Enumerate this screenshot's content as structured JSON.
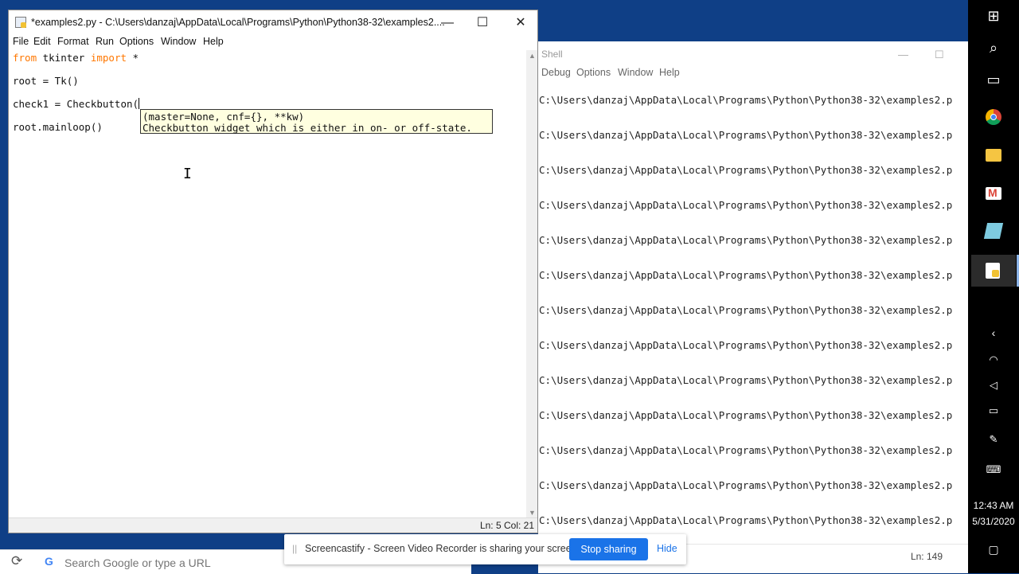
{
  "editor": {
    "title": "*examples2.py - C:\\Users\\danzaj\\AppData\\Local\\Programs\\Python\\Python38-32\\examples2....",
    "controls": {
      "minimize": "—",
      "maximize": "☐",
      "close": "✕"
    },
    "menu": [
      "File",
      "Edit",
      "Format",
      "Run",
      "Options",
      "Window",
      "Help"
    ],
    "code": {
      "line1_kw1": "from",
      "line1_mid": " tkinter ",
      "line1_kw2": "import",
      "line1_end": " *",
      "line3": "root = Tk()",
      "line5": "check1 = Checkbutton(",
      "line7": "root.mainloop()"
    },
    "tooltip": {
      "signature": "(master=None, cnf={}, **kw)",
      "doc": "Checkbutton widget which is either in on- or off-state."
    },
    "status": "Ln: 5   Col: 21"
  },
  "shell": {
    "title": "Shell",
    "menu": [
      "Debug",
      "Options",
      "Window",
      "Help"
    ],
    "line_text": "C:\\Users\\danzaj\\AppData\\Local\\Programs\\Python\\Python38-32\\examples2.p",
    "lines": [
      "C:\\Users\\danzaj\\AppData\\Local\\Programs\\Python\\Python38-32\\examples2.p",
      "C:\\Users\\danzaj\\AppData\\Local\\Programs\\Python\\Python38-32\\examples2.p",
      "C:\\Users\\danzaj\\AppData\\Local\\Programs\\Python\\Python38-32\\examples2.p",
      "C:\\Users\\danzaj\\AppData\\Local\\Programs\\Python\\Python38-32\\examples2.p",
      "C:\\Users\\danzaj\\AppData\\Local\\Programs\\Python\\Python38-32\\examples2.p",
      "C:\\Users\\danzaj\\AppData\\Local\\Programs\\Python\\Python38-32\\examples2.p",
      "C:\\Users\\danzaj\\AppData\\Local\\Programs\\Python\\Python38-32\\examples2.p",
      "C:\\Users\\danzaj\\AppData\\Local\\Programs\\Python\\Python38-32\\examples2.p",
      "C:\\Users\\danzaj\\AppData\\Local\\Programs\\Python\\Python38-32\\examples2.p",
      "C:\\Users\\danzaj\\AppData\\Local\\Programs\\Python\\Python38-32\\examples2.p",
      "C:\\Users\\danzaj\\AppData\\Local\\Programs\\Python\\Python38-32\\examples2.p",
      "C:\\Users\\danzaj\\AppData\\Local\\Programs\\Python\\Python38-32\\examples2.p",
      "C:\\Users\\danzaj\\AppData\\Local\\Programs\\Python\\Python38-32\\examples2.p"
    ],
    "status": "Ln: 149"
  },
  "browser": {
    "search_placeholder": "Search Google or type a URL",
    "google_glyph": "G"
  },
  "screencastify": {
    "message": "Screencastify - Screen Video Recorder is sharing your screen.",
    "stop_label": "Stop sharing",
    "hide_label": "Hide"
  },
  "taskbar": {
    "time": "12:43 AM",
    "date": "5/31/2020"
  },
  "colors": {
    "keyword": "#ff7700",
    "desktop": "#0f3f86",
    "stop_button": "#1a73e8",
    "tooltip_bg": "#ffffe0"
  }
}
